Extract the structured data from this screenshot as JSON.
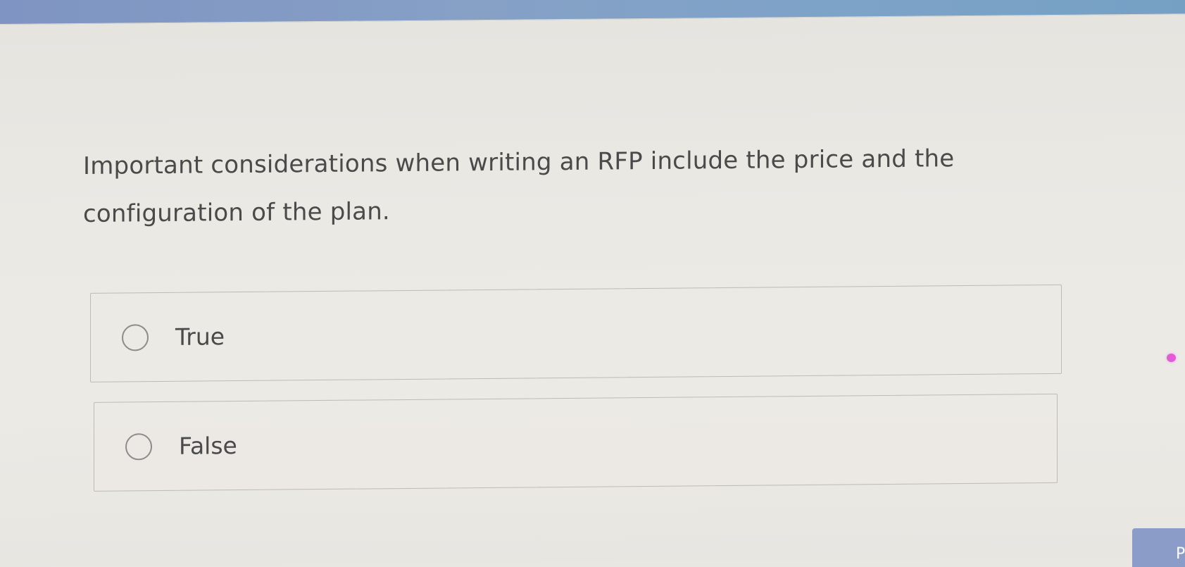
{
  "question": {
    "text": "Important considerations when writing an RFP include the price and the configuration of the plan."
  },
  "options": [
    {
      "label": "True",
      "selected": false
    },
    {
      "label": "False",
      "selected": false
    }
  ],
  "footer": {
    "next_label": "P"
  },
  "colors": {
    "accent": "#8b9cc9",
    "text": "#4a4a4a",
    "border": "#bdbbb6",
    "background": "#eae8e3"
  }
}
